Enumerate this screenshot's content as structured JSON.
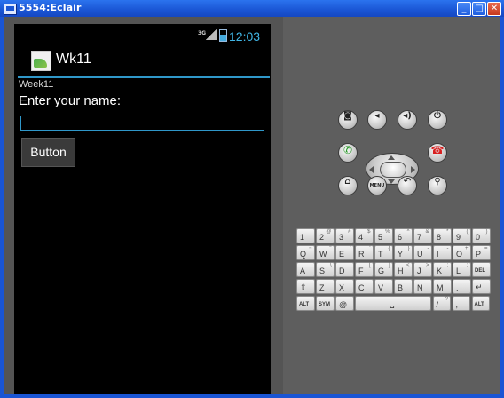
{
  "window": {
    "title": "5554:Eclair",
    "minimize_glyph": "_",
    "maximize_glyph": "□",
    "close_glyph": "✕"
  },
  "statusbar": {
    "network": "3G",
    "time": "12:03"
  },
  "app": {
    "title": "Wk11",
    "week_label": "Week11",
    "prompt": "Enter your name:",
    "name_value": "",
    "button_label": "Button"
  },
  "hardware": {
    "menu_label": "MENU",
    "buttons": [
      "camera",
      "volume-down",
      "volume-up",
      "power",
      "call",
      "end-call",
      "home",
      "menu",
      "back",
      "search"
    ]
  },
  "keyboard": {
    "row1": [
      {
        "main": "1",
        "alt": "!"
      },
      {
        "main": "2",
        "alt": "@"
      },
      {
        "main": "3",
        "alt": "#"
      },
      {
        "main": "4",
        "alt": "$"
      },
      {
        "main": "5",
        "alt": "%"
      },
      {
        "main": "6",
        "alt": "^"
      },
      {
        "main": "7",
        "alt": "&"
      },
      {
        "main": "8",
        "alt": "*"
      },
      {
        "main": "9",
        "alt": "("
      },
      {
        "main": "0",
        "alt": ")"
      }
    ],
    "row2": [
      {
        "main": "Q",
        "alt": "~"
      },
      {
        "main": "W",
        "alt": "\""
      },
      {
        "main": "E",
        "alt": "'"
      },
      {
        "main": "R",
        "alt": "'"
      },
      {
        "main": "T",
        "alt": "{"
      },
      {
        "main": "Y",
        "alt": "}"
      },
      {
        "main": "U",
        "alt": "-"
      },
      {
        "main": "I",
        "alt": "-"
      },
      {
        "main": "O",
        "alt": "+"
      },
      {
        "main": "P",
        "alt": "="
      }
    ],
    "row3": [
      {
        "main": "A",
        "alt": ""
      },
      {
        "main": "S",
        "alt": "\\"
      },
      {
        "main": "D",
        "alt": ""
      },
      {
        "main": "F",
        "alt": "["
      },
      {
        "main": "G",
        "alt": "]"
      },
      {
        "main": "H",
        "alt": "<"
      },
      {
        "main": "J",
        "alt": ">"
      },
      {
        "main": "K",
        "alt": ";"
      },
      {
        "main": "L",
        "alt": ":"
      },
      {
        "main": "DEL",
        "alt": ""
      }
    ],
    "row4": [
      {
        "main": "⇧",
        "alt": ""
      },
      {
        "main": "Z",
        "alt": ""
      },
      {
        "main": "X",
        "alt": ""
      },
      {
        "main": "C",
        "alt": ""
      },
      {
        "main": "V",
        "alt": ""
      },
      {
        "main": "B",
        "alt": ""
      },
      {
        "main": "N",
        "alt": ""
      },
      {
        "main": "M",
        "alt": ""
      },
      {
        "main": ".",
        "alt": ""
      },
      {
        "main": "↵",
        "alt": ""
      }
    ],
    "row5": [
      {
        "main": "ALT",
        "alt": ""
      },
      {
        "main": "SYM",
        "alt": ""
      },
      {
        "main": "@",
        "alt": ""
      },
      {
        "main": "␣",
        "alt": ""
      },
      {
        "main": "/",
        "alt": "?"
      },
      {
        "main": ",",
        "alt": ""
      },
      {
        "main": "ALT",
        "alt": ""
      }
    ]
  },
  "colors": {
    "accent": "#2f97c9",
    "clock": "#41b6e6",
    "window_blue": "#1a55d4"
  }
}
